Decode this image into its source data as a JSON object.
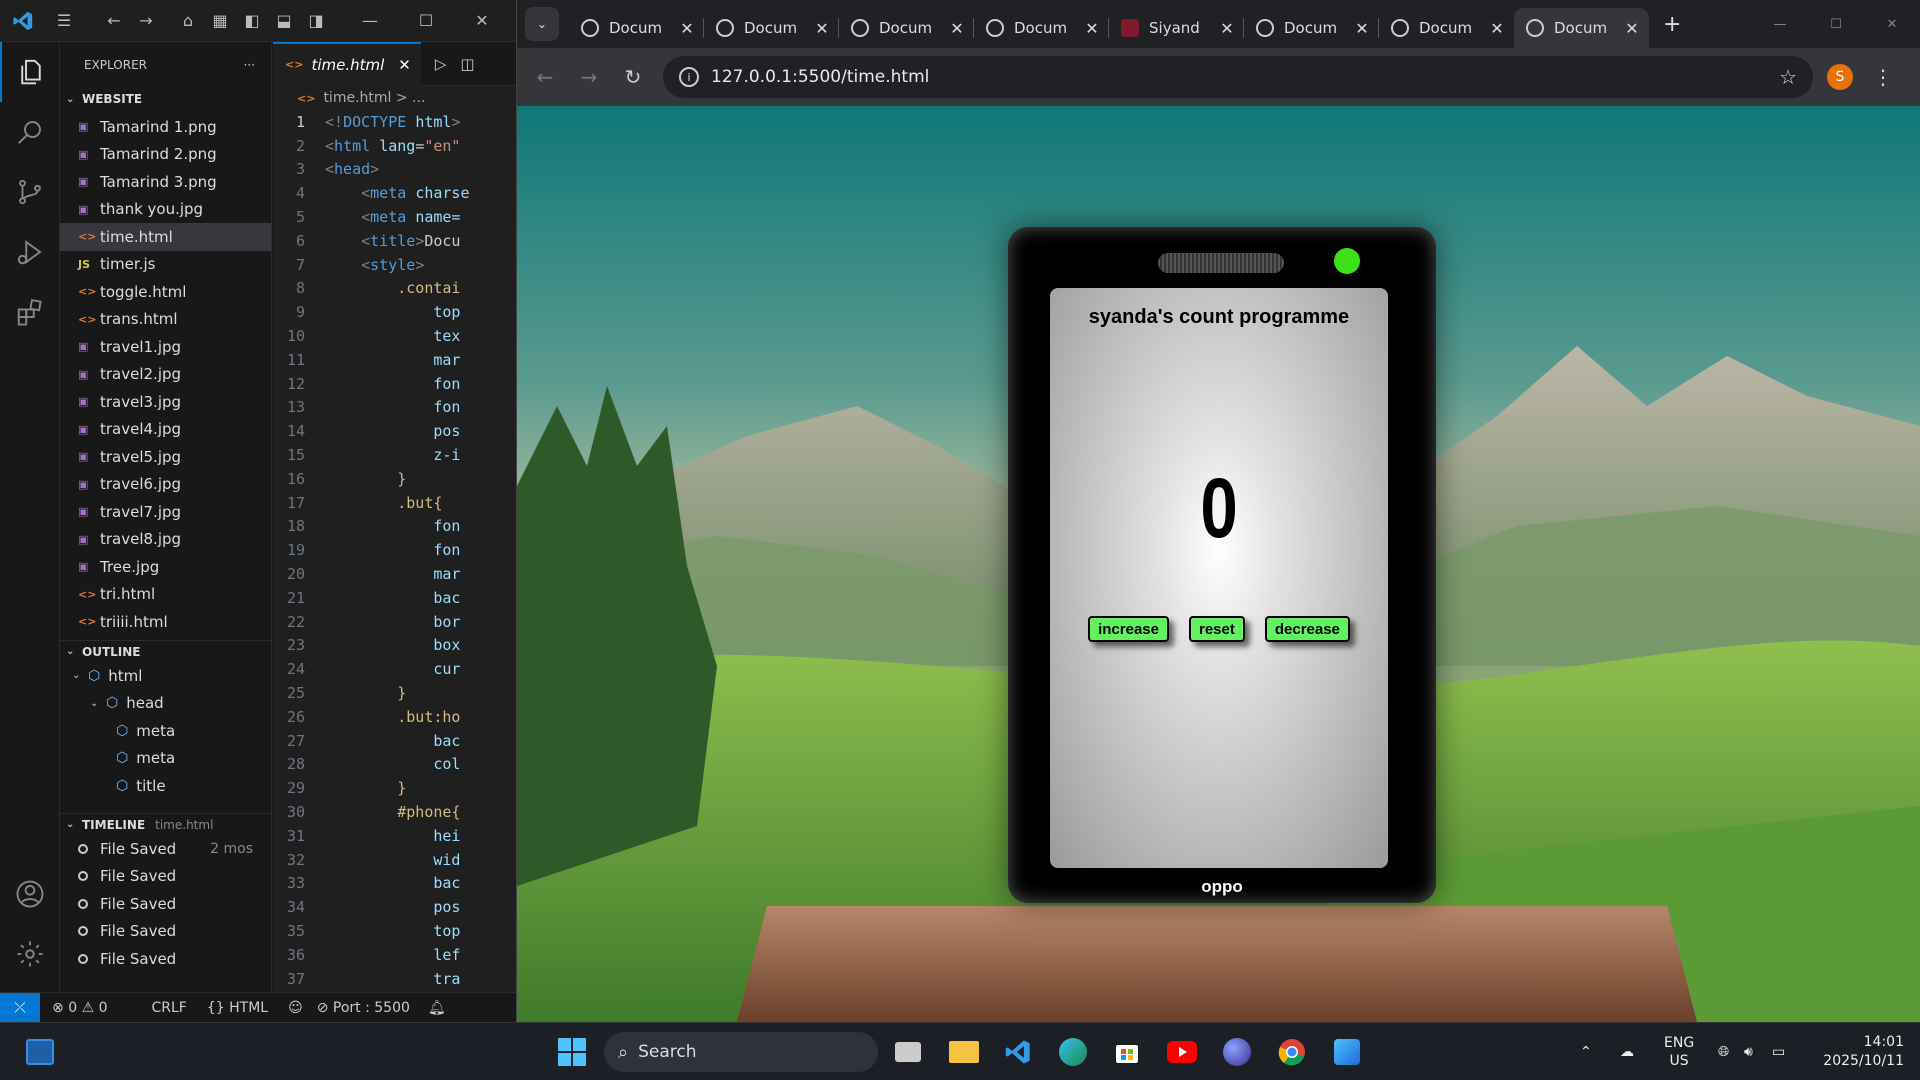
{
  "vscode": {
    "explorer_label": "EXPLORER",
    "workspace": "WEBSITE",
    "files": [
      {
        "name": "Tamarind 1.png",
        "type": "img"
      },
      {
        "name": "Tamarind 2.png",
        "type": "img"
      },
      {
        "name": "Tamarind 3.png",
        "type": "img"
      },
      {
        "name": "thank you.jpg",
        "type": "img"
      },
      {
        "name": "time.html",
        "type": "html",
        "selected": true
      },
      {
        "name": "timer.js",
        "type": "js"
      },
      {
        "name": "toggle.html",
        "type": "html"
      },
      {
        "name": "trans.html",
        "type": "html"
      },
      {
        "name": "travel1.jpg",
        "type": "img"
      },
      {
        "name": "travel2.jpg",
        "type": "img"
      },
      {
        "name": "travel3.jpg",
        "type": "img"
      },
      {
        "name": "travel4.jpg",
        "type": "img"
      },
      {
        "name": "travel5.jpg",
        "type": "img"
      },
      {
        "name": "travel6.jpg",
        "type": "img"
      },
      {
        "name": "travel7.jpg",
        "type": "img"
      },
      {
        "name": "travel8.jpg",
        "type": "img"
      },
      {
        "name": "Tree.jpg",
        "type": "img"
      },
      {
        "name": "tri.html",
        "type": "html"
      },
      {
        "name": "triiii.html",
        "type": "html"
      }
    ],
    "outline_label": "OUTLINE",
    "outline": [
      {
        "label": "html",
        "depth": 0
      },
      {
        "label": "head",
        "depth": 1
      },
      {
        "label": "meta",
        "depth": 2
      },
      {
        "label": "meta",
        "depth": 2
      },
      {
        "label": "title",
        "depth": 2
      }
    ],
    "timeline_label": "TIMELINE",
    "timeline_file": "time.html",
    "timeline": [
      {
        "label": "File Saved",
        "ago": "2 mos"
      },
      {
        "label": "File Saved",
        "ago": ""
      },
      {
        "label": "File Saved",
        "ago": ""
      },
      {
        "label": "File Saved",
        "ago": ""
      },
      {
        "label": "File Saved",
        "ago": ""
      }
    ],
    "tab_name": "time.html",
    "breadcrumb": "time.html > ...",
    "code": [
      [
        [
          "gray",
          "<!"
        ],
        [
          "tag",
          "DOCTYPE "
        ],
        [
          "attr",
          "html"
        ],
        [
          "gray",
          ">"
        ]
      ],
      [
        [
          "gray",
          "<"
        ],
        [
          "tag",
          "html "
        ],
        [
          "attr",
          "lang"
        ],
        [
          "txt",
          "="
        ],
        [
          "str",
          "\"en\""
        ]
      ],
      [
        [
          "gray",
          "<"
        ],
        [
          "tag",
          "head"
        ],
        [
          "gray",
          ">"
        ]
      ],
      [
        [
          "txt",
          "    "
        ],
        [
          "gray",
          "<"
        ],
        [
          "tag",
          "meta "
        ],
        [
          "attr",
          "charse"
        ]
      ],
      [
        [
          "txt",
          "    "
        ],
        [
          "gray",
          "<"
        ],
        [
          "tag",
          "meta "
        ],
        [
          "attr",
          "name="
        ]
      ],
      [
        [
          "txt",
          "    "
        ],
        [
          "gray",
          "<"
        ],
        [
          "tag",
          "title"
        ],
        [
          "gray",
          ">"
        ],
        [
          "txt",
          "Docu"
        ]
      ],
      [
        [
          "txt",
          "    "
        ],
        [
          "gray",
          "<"
        ],
        [
          "tag",
          "style"
        ],
        [
          "gray",
          ">"
        ]
      ],
      [
        [
          "txt",
          "        "
        ],
        [
          "sel",
          ".contai"
        ]
      ],
      [
        [
          "txt",
          "            "
        ],
        [
          "attr",
          "top"
        ]
      ],
      [
        [
          "txt",
          "            "
        ],
        [
          "attr",
          "tex"
        ]
      ],
      [
        [
          "txt",
          "            "
        ],
        [
          "attr",
          "mar"
        ]
      ],
      [
        [
          "txt",
          "            "
        ],
        [
          "attr",
          "fon"
        ]
      ],
      [
        [
          "txt",
          "            "
        ],
        [
          "attr",
          "fon"
        ]
      ],
      [
        [
          "txt",
          "            "
        ],
        [
          "attr",
          "pos"
        ]
      ],
      [
        [
          "txt",
          "            "
        ],
        [
          "attr",
          "z-i"
        ]
      ],
      [
        [
          "txt",
          "        "
        ],
        [
          "sel",
          "}"
        ]
      ],
      [
        [
          "txt",
          "        "
        ],
        [
          "sel",
          ".but{"
        ]
      ],
      [
        [
          "txt",
          "            "
        ],
        [
          "attr",
          "fon"
        ]
      ],
      [
        [
          "txt",
          "            "
        ],
        [
          "attr",
          "fon"
        ]
      ],
      [
        [
          "txt",
          "            "
        ],
        [
          "attr",
          "mar"
        ]
      ],
      [
        [
          "txt",
          "            "
        ],
        [
          "attr",
          "bac"
        ]
      ],
      [
        [
          "txt",
          "            "
        ],
        [
          "attr",
          "bor"
        ]
      ],
      [
        [
          "txt",
          "            "
        ],
        [
          "attr",
          "box"
        ]
      ],
      [
        [
          "txt",
          "            "
        ],
        [
          "attr",
          "cur"
        ]
      ],
      [
        [
          "txt",
          "        "
        ],
        [
          "sel",
          "}"
        ]
      ],
      [
        [
          "txt",
          "        "
        ],
        [
          "sel",
          ".but:ho"
        ]
      ],
      [
        [
          "txt",
          "            "
        ],
        [
          "attr",
          "bac"
        ]
      ],
      [
        [
          "txt",
          "            "
        ],
        [
          "attr",
          "col"
        ]
      ],
      [
        [
          "txt",
          "        "
        ],
        [
          "sel",
          "}"
        ]
      ],
      [
        [
          "txt",
          "        "
        ],
        [
          "sel",
          "#phone{"
        ]
      ],
      [
        [
          "txt",
          "            "
        ],
        [
          "attr",
          "hei"
        ]
      ],
      [
        [
          "txt",
          "            "
        ],
        [
          "attr",
          "wid"
        ]
      ],
      [
        [
          "txt",
          "            "
        ],
        [
          "attr",
          "bac"
        ]
      ],
      [
        [
          "txt",
          "            "
        ],
        [
          "attr",
          "pos"
        ]
      ],
      [
        [
          "txt",
          "            "
        ],
        [
          "attr",
          "top"
        ]
      ],
      [
        [
          "txt",
          "            "
        ],
        [
          "attr",
          "lef"
        ]
      ],
      [
        [
          "txt",
          "            "
        ],
        [
          "attr",
          "tra"
        ]
      ]
    ],
    "status": {
      "errors": "0",
      "warnings": "0",
      "eol": "CRLF",
      "language": "HTML",
      "port": "Port : 5500"
    }
  },
  "chrome": {
    "tabs": [
      {
        "title": "Docum",
        "active": false,
        "favicon": "globe"
      },
      {
        "title": "Docum",
        "active": false,
        "favicon": "globe"
      },
      {
        "title": "Docum",
        "active": false,
        "favicon": "globe"
      },
      {
        "title": "Docum",
        "active": false,
        "favicon": "globe"
      },
      {
        "title": "Siyand",
        "active": false,
        "favicon": "app"
      },
      {
        "title": "Docum",
        "active": false,
        "favicon": "globe"
      },
      {
        "title": "Docum",
        "active": false,
        "favicon": "globe"
      },
      {
        "title": "Docum",
        "active": true,
        "favicon": "globe"
      }
    ],
    "url": "127.0.0.1:5500/time.html",
    "profile_initial": "S"
  },
  "page": {
    "title": "syanda's count programme",
    "count": "0",
    "buttons": {
      "increase": "increase",
      "reset": "reset",
      "decrease": "decrease"
    },
    "brand": "oppo",
    "button_color": "#61f161",
    "camera_color": "#3ee01c"
  },
  "taskbar": {
    "search_placeholder": "Search",
    "language": "ENG",
    "region": "US",
    "time": "14:01",
    "date": "2025/10/11"
  }
}
